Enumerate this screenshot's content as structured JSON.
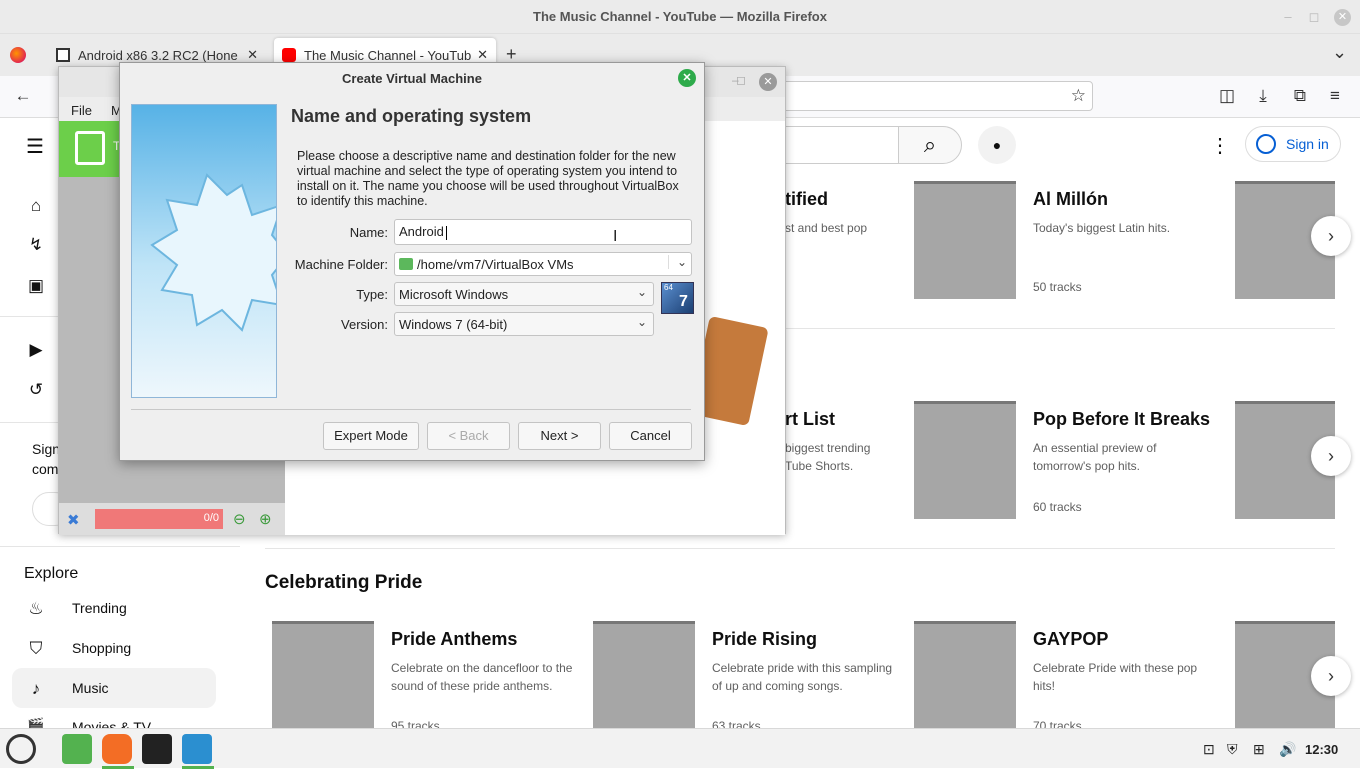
{
  "window": {
    "title": "The Music Channel - YouTube — Mozilla Firefox",
    "minimize": "–",
    "maximize": "◻",
    "close": "✕"
  },
  "tabs": [
    {
      "label": "Android x86 3.2 RC2 (Hone",
      "close": "✕"
    },
    {
      "label": "The Music Channel - YouTub",
      "close": "✕"
    }
  ],
  "tabbar": {
    "new_tab": "+",
    "list_all": "⌄"
  },
  "nav": {
    "back": "←",
    "bookmark": "☆",
    "pocket": "◫",
    "downloads": "⤓",
    "extensions": "⧉",
    "menu": "≡"
  },
  "youtube": {
    "menu": "☰",
    "search_icon": "⌕",
    "mic_icon": "●",
    "more": "⋮",
    "sign_in": "Sign in",
    "sidebar": {
      "home": "⌂",
      "shorts": "↯",
      "subs": "▣",
      "you": "▶",
      "history": "↺",
      "sign_text_1": "Sign",
      "sign_text_2": "com",
      "explore_heading": "Explore",
      "items": [
        {
          "icon": "♨",
          "label": "Trending"
        },
        {
          "icon": "⛉",
          "label": "Shopping"
        },
        {
          "icon": "♪",
          "label": "Music"
        },
        {
          "icon": "🎬",
          "label": "Movies & TV"
        }
      ]
    },
    "row1": [
      {
        "title": "tified",
        "desc": "st and best pop"
      },
      {
        "title": "Al Millón",
        "desc": "Today's biggest Latin hits.",
        "count": "50 tracks"
      }
    ],
    "row2": [
      {
        "title": "rt List",
        "desc": "biggest trending\nTube Shorts."
      },
      {
        "title": "Pop Before It Breaks",
        "desc": "An essential preview of tomorrow's pop hits.",
        "count": "60 tracks"
      }
    ],
    "section3_title": "Celebrating Pride",
    "row3": [
      {
        "title": "Pride Anthems",
        "desc": "Celebrate on the dancefloor to the sound of these pride anthems.",
        "count": "95 tracks"
      },
      {
        "title": "Pride Rising",
        "desc": "Celebrate pride with this sampling of up and coming songs.",
        "count": "63 tracks"
      },
      {
        "title": "GAYPOP",
        "desc": "Celebrate Pride with these pop hits!",
        "count": "70 tracks"
      }
    ],
    "next_arrow": "›"
  },
  "vbox_manager": {
    "menu_file": "File",
    "menu_m": "M",
    "status_value": "0/0",
    "min": "–",
    "max": "◻",
    "close": "✕",
    "green_tool": "T"
  },
  "dialog": {
    "title": "Create Virtual Machine",
    "heading": "Name and operating system",
    "description": "Please choose a descriptive name and destination folder for the new virtual machine and select the type of operating system you intend to install on it. The name you choose will be used throughout VirtualBox to identify this machine.",
    "name_label": "Name:",
    "name_value": "Android",
    "folder_label": "Machine Folder:",
    "folder_value": "/home/vm7/VirtualBox VMs",
    "type_label": "Type:",
    "type_value": "Microsoft Windows",
    "version_label": "Version:",
    "version_value": "Windows 7 (64-bit)",
    "os_badge_top": "64",
    "os_badge_num": "7",
    "buttons": {
      "expert": "Expert Mode",
      "back": "< Back",
      "next": "Next >",
      "cancel": "Cancel"
    },
    "close": "✕",
    "chevron": "⌄"
  },
  "taskbar": {
    "clock": "12:30",
    "tray_icons": [
      "⊡",
      "⛨",
      "⊞",
      "🔊"
    ]
  }
}
